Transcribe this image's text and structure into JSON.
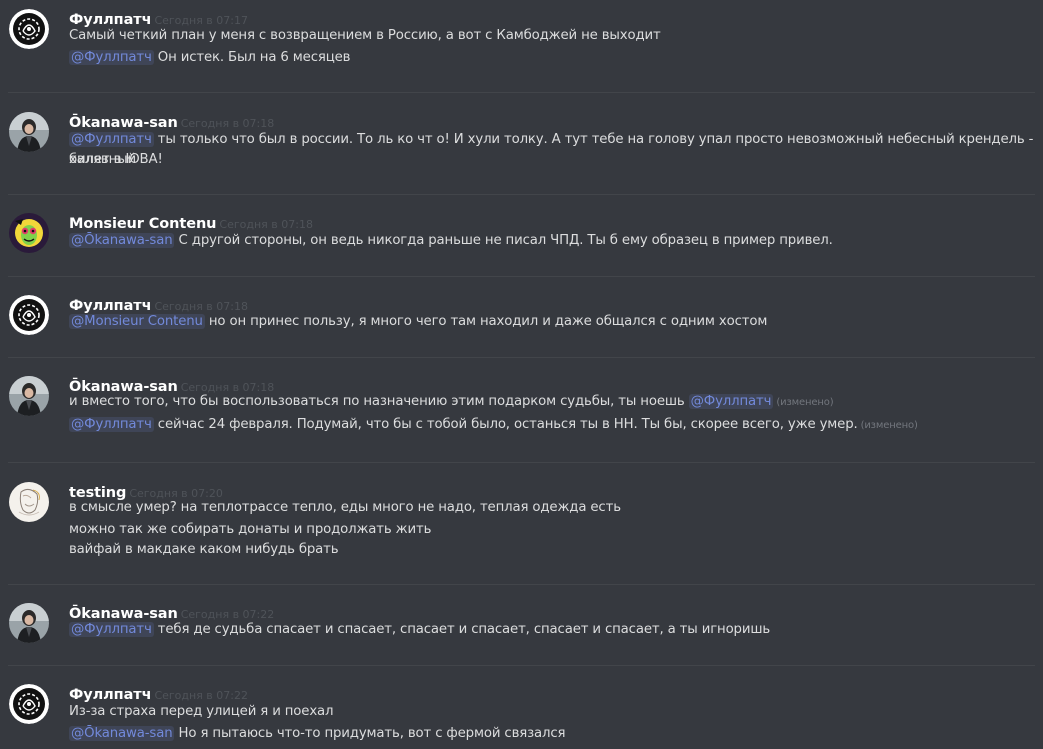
{
  "colors": {
    "background": "#36393f",
    "username": "#ffffff",
    "timestamp": "#4f5359",
    "text": "#dcddde",
    "mention": "#7289da",
    "edited": "#72767d"
  },
  "messages": [
    {
      "author": "Фуллпатч",
      "avatar": "fullpatch-avatar",
      "time": "Сегодня в 07:17",
      "lines": [
        {
          "text": "Самый четкий план у меня с возвращением в Россию, а вот с Камбоджей не выходит"
        },
        {
          "mention": "@Фуллпатч",
          "text": " Он истек. Был на 6 месяцев"
        }
      ]
    },
    {
      "author": "Ōkanawa-san",
      "avatar": "okanawa-avatar",
      "time": "Сегодня в 07:18",
      "lines": [
        {
          "mention": "@Фуллпатч",
          "text": " ты только что был в россии. То ль ко чт о! И хули толку. А тут тебе на голову упал просто невозможный небесный крендель - халявный"
        },
        {
          "text": "билет в ЮВА!"
        }
      ]
    },
    {
      "author": "Monsieur Contenu",
      "avatar": "monsieur-avatar",
      "time": "Сегодня в 07:18",
      "lines": [
        {
          "mention": "@Ōkanawa-san",
          "text": " С другой стороны, он ведь никогда раньше не писал ЧПД. Ты б ему образец в пример привел."
        }
      ]
    },
    {
      "author": "Фуллпатч",
      "avatar": "fullpatch-avatar",
      "time": "Сегодня в 07:18",
      "lines": [
        {
          "mention": "@Monsieur Contenu",
          "text": " но он принес пользу, я много чего там находил и даже общался с одним хостом"
        }
      ]
    },
    {
      "author": "Ōkanawa-san",
      "avatar": "okanawa-avatar",
      "time": "Сегодня в 07:18",
      "lines": [
        {
          "text": "и вместо того, что бы воспользоваться по назначению этим подарком судьбы, ты ноешь ",
          "mention_after": "@Фуллпатч",
          "edited": "(изменено)"
        },
        {
          "mention": "@Фуллпатч",
          "text": " сейчас 24 февраля. Подумай, что бы с тобой было, останься ты в НН. Ты бы, скорее всего, уже умер.",
          "edited": "(изменено)"
        }
      ]
    },
    {
      "author": "testing",
      "avatar": "testing-avatar",
      "time": "Сегодня в 07:20",
      "lines": [
        {
          "text": "в смысле умер? на теплотрассе тепло, еды много не надо, теплая одежда есть"
        },
        {
          "text": "можно так же собирать донаты и продолжать жить"
        },
        {
          "text": "вайфай в макдаке каком нибудь брать"
        }
      ]
    },
    {
      "author": "Ōkanawa-san",
      "avatar": "okanawa-avatar",
      "time": "Сегодня в 07:22",
      "lines": [
        {
          "mention": "@Фуллпатч",
          "text": " тебя де судьба спасает и спасает, спасает и спасает, спасает и спасает, а ты игноришь"
        }
      ]
    },
    {
      "author": "Фуллпатч",
      "avatar": "fullpatch-avatar",
      "time": "Сегодня в 07:22",
      "lines": [
        {
          "text": "Из-за страха перед улицей я и поехал"
        },
        {
          "mention": "@Ōkanawa-san",
          "text": " Но я пытаюсь что-то придумать, вот с фермой связался"
        }
      ]
    }
  ]
}
